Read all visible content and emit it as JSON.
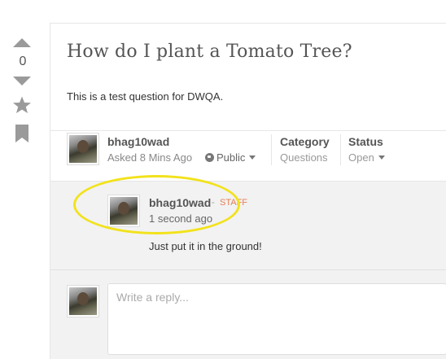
{
  "vote": {
    "count": "0"
  },
  "question": {
    "title": "How do I plant a Tomato Tree?",
    "content": "This is a test question for DWQA.",
    "author": "bhag10wad",
    "asked": "Asked 8 Mins Ago",
    "privacy": "Public",
    "category_label": "Category",
    "category_value": "Questions",
    "status_label": "Status",
    "status_value": "Open"
  },
  "comment": {
    "author": "bhag10wad",
    "separator": "-",
    "role": "STAFF",
    "time": "1 second ago",
    "text": "Just put it in the ground!"
  },
  "reply": {
    "placeholder": "Write a reply..."
  },
  "colors": {
    "highlight": "#f2e21b",
    "staff_role": "#e57e53",
    "icon_gray": "#9a9a9a"
  }
}
